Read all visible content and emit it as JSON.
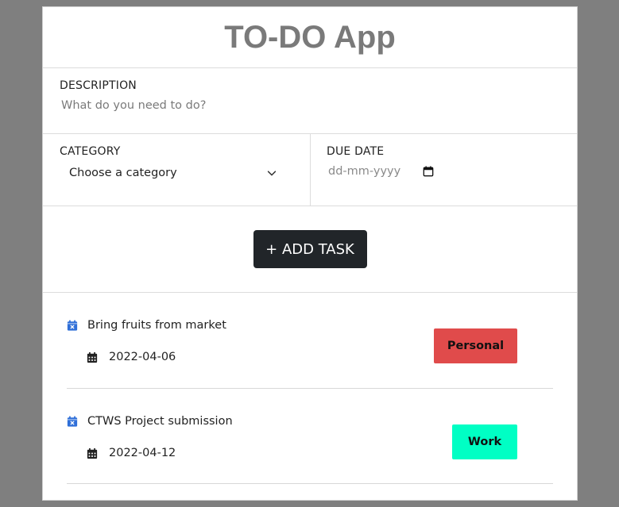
{
  "app": {
    "title": "TO-DO App"
  },
  "form": {
    "description_label": "DESCRIPTION",
    "description_placeholder": "What do you need to do?",
    "category_label": "CATEGORY",
    "category_value": "Choose a category",
    "due_date_label": "DUE DATE",
    "due_date_placeholder": "dd-mm-yyyy",
    "add_button_label": "+ ADD TASK"
  },
  "tasks": [
    {
      "name": "Bring fruits from market",
      "date": "2022-04-06",
      "category": "Personal",
      "color": "#e04b4b"
    },
    {
      "name": "CTWS Project submission",
      "date": "2022-04-12",
      "category": "Work",
      "color": "#00ffc4"
    }
  ],
  "colors": {
    "accent": "#2f6fd8",
    "button": "#212529"
  }
}
